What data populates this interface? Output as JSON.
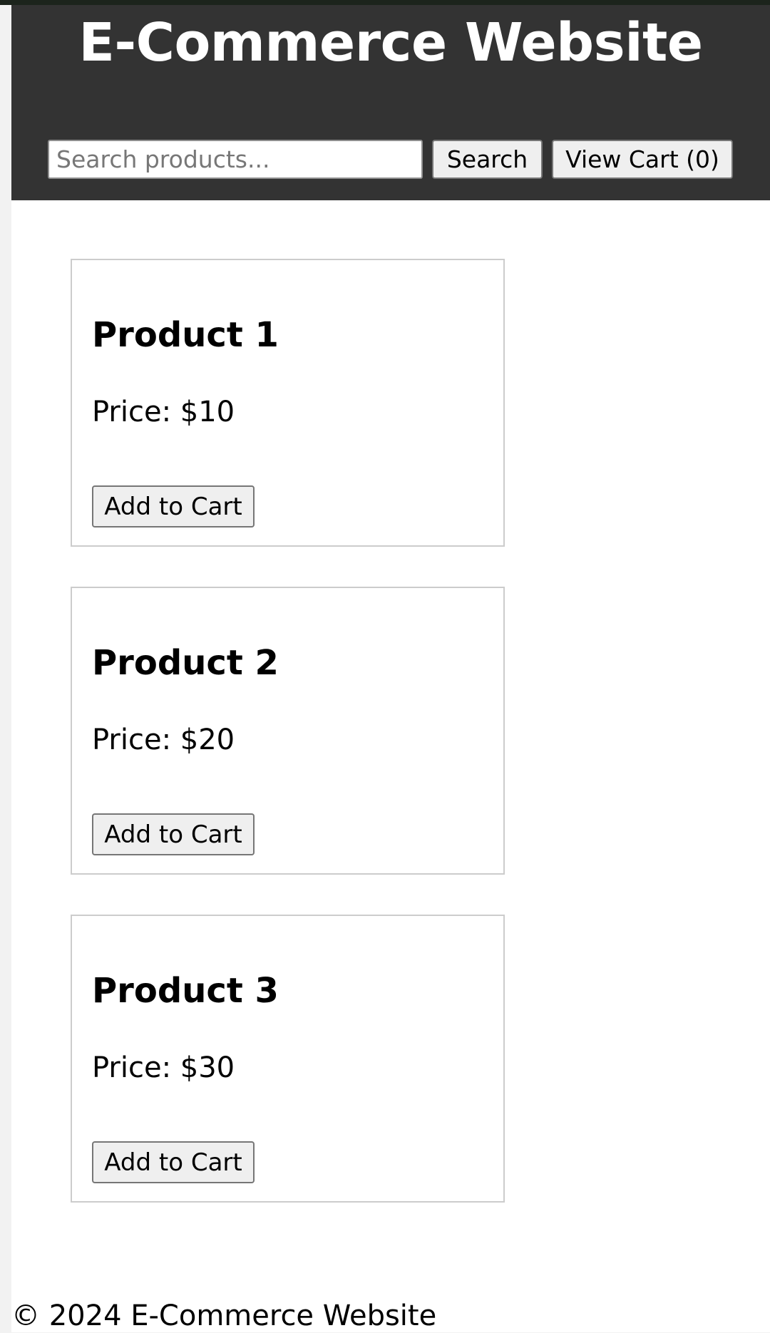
{
  "header": {
    "title": "E-Commerce Website",
    "search_placeholder": "Search products...",
    "search_value": "",
    "search_button_label": "Search",
    "cart_button_label": "View Cart (0)"
  },
  "products": [
    {
      "name": "Product 1",
      "price": "Price: $10",
      "button_label": "Add to Cart"
    },
    {
      "name": "Product 2",
      "price": "Price: $20",
      "button_label": "Add to Cart"
    },
    {
      "name": "Product 3",
      "price": "Price: $30",
      "button_label": "Add to Cart"
    }
  ],
  "footer": {
    "text": "© 2024 E-Commerce Website"
  },
  "colors": {
    "header_background": "#333333",
    "header_text": "#ffffff",
    "page_background": "#ffffff",
    "button_background": "#efefef",
    "card_border": "#cccccc"
  }
}
